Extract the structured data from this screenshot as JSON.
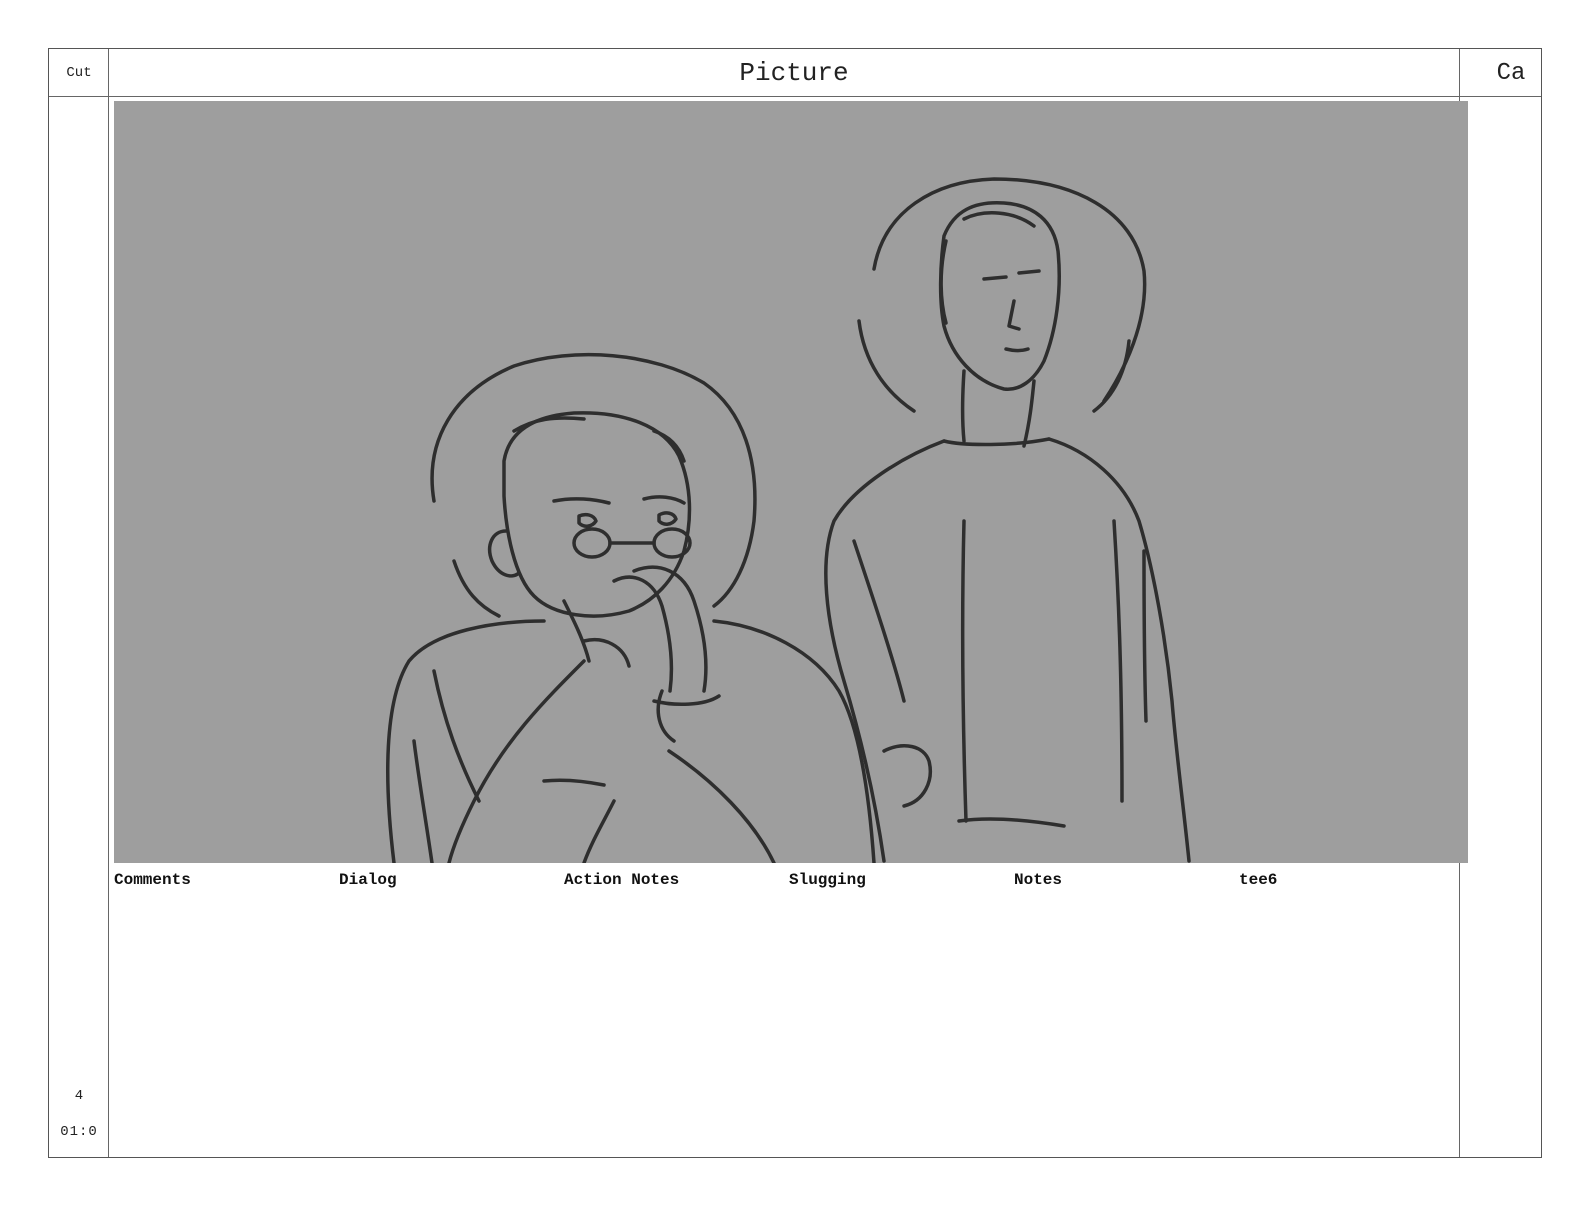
{
  "header": {
    "cut_label": "Cut",
    "picture_label": "Picture",
    "camera_label": "Ca"
  },
  "panel": {
    "background_color": "#9e9e9e",
    "line_color": "#2e2e2e",
    "illustration": "sketch-two-figures"
  },
  "columns": [
    {
      "label": "Comments"
    },
    {
      "label": "Dialog"
    },
    {
      "label": "Action Notes"
    },
    {
      "label": "Slugging"
    },
    {
      "label": "Notes"
    },
    {
      "label": "tee6"
    }
  ],
  "cut": {
    "number": "4",
    "duration": "01:0"
  }
}
